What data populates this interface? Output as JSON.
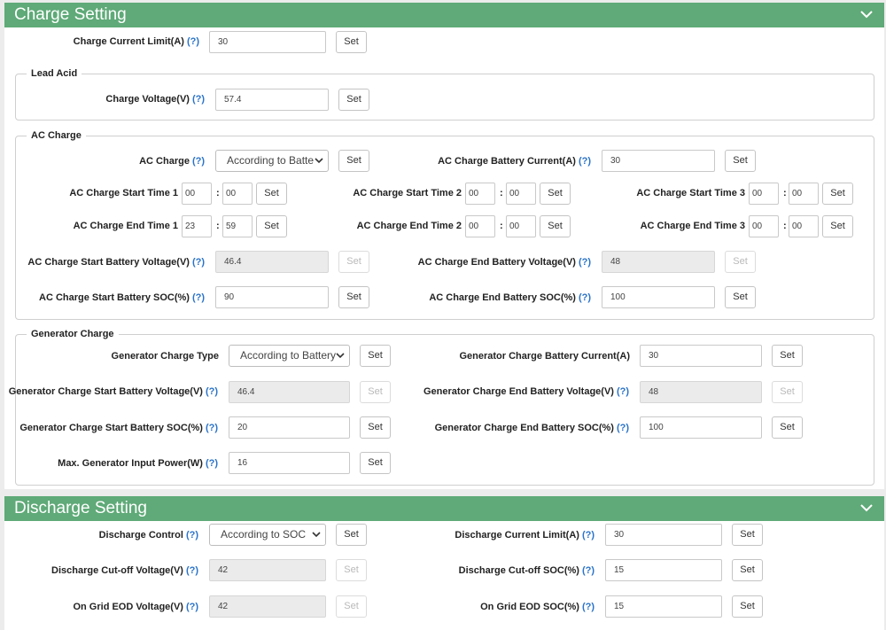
{
  "colors": {
    "header_bg": "#5faa78",
    "help_link": "#2a73c9",
    "page_bg": "#ececec",
    "disabled_input_bg": "#ebebeb"
  },
  "icons": {
    "collapse": "chevron-down-icon",
    "dropdown": "chevron-down-icon"
  },
  "set_label": "Set",
  "help_label": "(?)",
  "time_sep": ":",
  "charge": {
    "title": "Charge Setting",
    "current_limit": {
      "label": "Charge Current Limit(A)",
      "value": "30"
    },
    "lead_acid": {
      "legend": "Lead Acid",
      "voltage": {
        "label": "Charge Voltage(V)",
        "value": "57.4"
      }
    },
    "ac": {
      "legend": "AC Charge",
      "ac_charge": {
        "label": "AC Charge",
        "value": "According to Batte"
      },
      "battery_current": {
        "label": "AC Charge Battery Current(A)",
        "value": "30"
      },
      "start1": {
        "label": "AC Charge Start Time 1",
        "hh": "00",
        "mm": "00"
      },
      "start2": {
        "label": "AC Charge Start Time 2",
        "hh": "00",
        "mm": "00"
      },
      "start3": {
        "label": "AC Charge Start Time 3",
        "hh": "00",
        "mm": "00"
      },
      "end1": {
        "label": "AC Charge End Time 1",
        "hh": "23",
        "mm": "59"
      },
      "end2": {
        "label": "AC Charge End Time 2",
        "hh": "00",
        "mm": "00"
      },
      "end3": {
        "label": "AC Charge End Time 3",
        "hh": "00",
        "mm": "00"
      },
      "start_voltage": {
        "label": "AC Charge Start Battery Voltage(V)",
        "value": "46.4"
      },
      "end_voltage": {
        "label": "AC Charge End Battery Voltage(V)",
        "value": "48"
      },
      "start_soc": {
        "label": "AC Charge Start Battery SOC(%)",
        "value": "90"
      },
      "end_soc": {
        "label": "AC Charge End Battery SOC(%)",
        "value": "100"
      }
    },
    "gen": {
      "legend": "Generator Charge",
      "type": {
        "label": "Generator Charge Type",
        "value": "According to Battery"
      },
      "battery_current": {
        "label": "Generator Charge Battery Current(A)",
        "value": "30"
      },
      "start_voltage": {
        "label": "Generator Charge Start Battery Voltage(V)",
        "value": "46.4"
      },
      "end_voltage": {
        "label": "Generator Charge End Battery Voltage(V)",
        "value": "48"
      },
      "start_soc": {
        "label": "Generator Charge Start Battery SOC(%)",
        "value": "20"
      },
      "end_soc": {
        "label": "Generator Charge End Battery SOC(%)",
        "value": "100"
      },
      "max_power": {
        "label": "Max. Generator Input Power(W)",
        "value": "16"
      }
    }
  },
  "discharge": {
    "title": "Discharge Setting",
    "control": {
      "label": "Discharge Control",
      "value": "According to SOC"
    },
    "current_limit": {
      "label": "Discharge Current Limit(A)",
      "value": "30"
    },
    "cutoff_voltage": {
      "label": "Discharge Cut-off Voltage(V)",
      "value": "42"
    },
    "cutoff_soc": {
      "label": "Discharge Cut-off SOC(%)",
      "value": "15"
    },
    "ongrid_eod_voltage": {
      "label": "On Grid EOD Voltage(V)",
      "value": "42"
    },
    "ongrid_eod_soc": {
      "label": "On Grid EOD SOC(%)",
      "value": "15"
    }
  }
}
